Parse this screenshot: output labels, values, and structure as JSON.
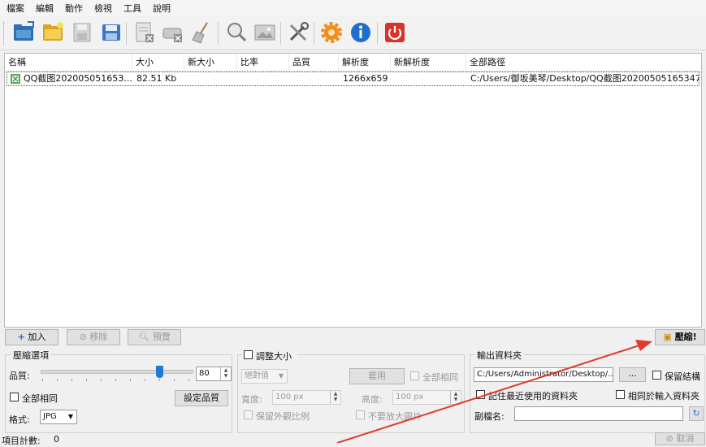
{
  "menu": [
    "檔案",
    "編輯",
    "動作",
    "檢視",
    "工具",
    "說明"
  ],
  "toolbar_icons": [
    "open-folder-blue-icon",
    "open-folder-yellow-icon",
    "save-disabled-icon",
    "save-blue-icon",
    "document-remove-icon",
    "drive-remove-icon",
    "broom-clear-icon",
    "zoom-icon",
    "image-preview-icon",
    "tools-icon",
    "settings-gear-icon",
    "info-icon",
    "power-icon"
  ],
  "columns": [
    "名稱",
    "大小",
    "新大小",
    "比率",
    "品質",
    "解析度",
    "新解析度",
    "全部路徑"
  ],
  "rows": [
    {
      "name": "QQ截图20200505165З...",
      "size": "82.51 Kb",
      "new_size": "",
      "ratio": "",
      "quality": "",
      "resolution": "1266x659",
      "new_resolution": "",
      "path": "C:/Users/御坂美琴/Desktop/QQ截图20200505165347...."
    }
  ],
  "buttons": {
    "add": "加入",
    "remove": "移除",
    "preview": "預覽",
    "compress": "壓縮!"
  },
  "compress_options": {
    "title": "壓縮選項",
    "quality_label": "品質:",
    "quality_value": "80",
    "quality_level": 0.8,
    "all_same": "全部相同",
    "set_quality": "設定品質",
    "format_label": "格式:",
    "format_value": "JPG"
  },
  "resize": {
    "title": "調整大小",
    "mode": "絕對值",
    "apply": "套用",
    "all_same": "全部相同",
    "width_label": "寬度:",
    "width_value": "100 px",
    "height_label": "高度:",
    "height_value": "100 px",
    "keep_ratio": "保留外觀比例",
    "no_enlarge": "不要放大圖片"
  },
  "output": {
    "title": "輸出資料夾",
    "path": "C:/Users/Administrator/Desktop/...",
    "browse": "...",
    "keep_structure": "保留結構",
    "remember_recent": "記住最近使用的資料夾",
    "same_as_input": "相同於輸入資料夾",
    "suffix_label": "副檔名:",
    "suffix_value": ""
  },
  "status": {
    "label": "項目計數:",
    "count": "0"
  },
  "cancel": "取消"
}
